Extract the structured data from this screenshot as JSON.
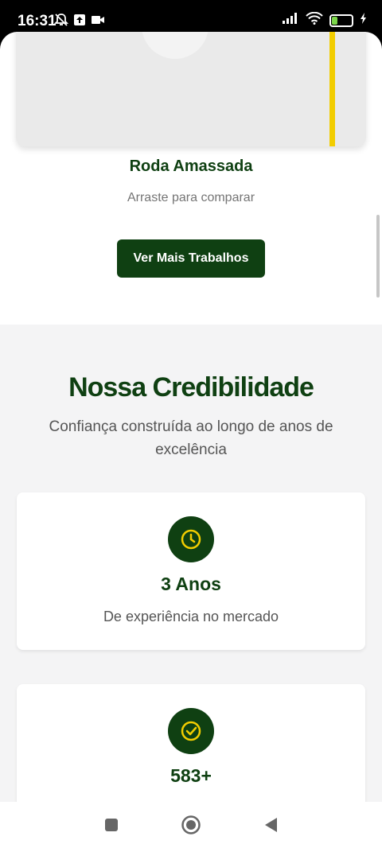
{
  "status_bar": {
    "time": "16:31",
    "battery": "28",
    "icons_left": [
      "mute-bell-icon",
      "upload-icon",
      "video-icon"
    ],
    "icons_right": [
      "signal-icon",
      "wifi-icon",
      "battery-icon",
      "charging-icon"
    ]
  },
  "comparison": {
    "title": "Roda Amassada",
    "hint": "Arraste para comparar",
    "button_label": "Ver Mais Trabalhos",
    "colors": {
      "handle": "#f2cd00",
      "primary": "#0f4012"
    }
  },
  "credibility": {
    "title": "Nossa Credibilidade",
    "subtitle": "Confiança construída ao longo de anos de excelência",
    "stats": [
      {
        "icon": "clock-icon",
        "value": "3 Anos",
        "label": "De experiência no mercado"
      },
      {
        "icon": "check-circle-icon",
        "value": "583+",
        "label": ""
      }
    ]
  },
  "nav": {
    "buttons": [
      "recent-apps-button",
      "home-button",
      "back-button"
    ]
  }
}
